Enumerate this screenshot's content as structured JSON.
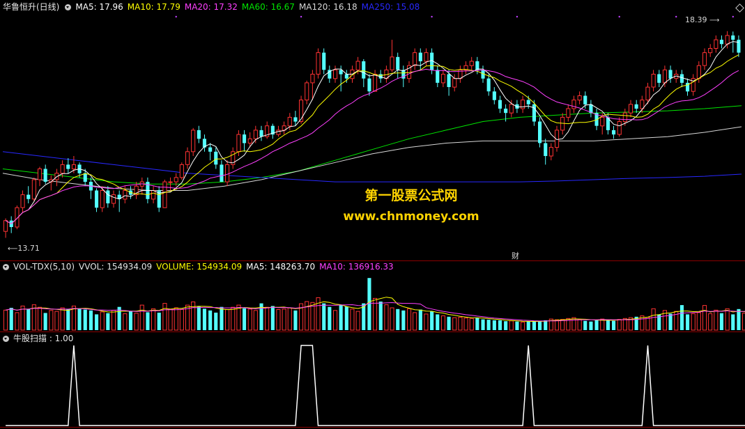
{
  "colors": {
    "up": "#ff3232",
    "down": "#54ffff",
    "ma5": "#ffffff",
    "ma10": "#ffff00",
    "ma20": "#ff40ff",
    "ma60": "#00e600",
    "ma120": "#d8d8d8",
    "ma250": "#2828ff",
    "bg": "#000000",
    "divider": "#8c0000",
    "vol_ma5": "#ffff00",
    "vol_ma10": "#ff40ff",
    "signal": "#ffffff",
    "watermark": "#ffd400",
    "marker_dot": "#c040ff"
  },
  "header": {
    "stock_name": "华鲁恒升(日线)",
    "ma_items": [
      {
        "label": "MA5: 17.96",
        "color": "#ffffff"
      },
      {
        "label": "MA10: 17.79",
        "color": "#ffff00"
      },
      {
        "label": "MA20: 17.32",
        "color": "#ff40ff"
      },
      {
        "label": "MA60: 16.67",
        "color": "#00e600"
      },
      {
        "label": "MA120: 16.18",
        "color": "#d8d8d8"
      },
      {
        "label": "MA250: 15.08",
        "color": "#2828ff"
      }
    ]
  },
  "volume_header": {
    "indicator": "VOL-TDX(5,10)",
    "items": [
      {
        "label": "VVOL: 154934.09",
        "color": "#e6e6e6"
      },
      {
        "label": "VOLUME: 154934.09",
        "color": "#ffff00"
      },
      {
        "label": "MA5: 148263.70",
        "color": "#ffffff"
      },
      {
        "label": "MA10: 136916.33",
        "color": "#ff40ff"
      }
    ]
  },
  "signal_header": {
    "label": "牛股扫描 : 1.00"
  },
  "watermark": {
    "line1": "第一股票公式网",
    "line2": "www.chnmoney.com"
  },
  "annotations": {
    "high_label": "18.39",
    "low_label": "13.71",
    "cai_marker": "财"
  },
  "chart_data": [
    {
      "type": "candlestick",
      "title": "华鲁恒升(日线)",
      "ylim": [
        13.3,
        18.8
      ],
      "candles": [
        [
          13.75,
          14.0,
          13.6,
          14.05
        ],
        [
          14.0,
          13.85,
          13.71,
          14.1
        ],
        [
          13.85,
          14.3,
          13.8,
          14.35
        ],
        [
          14.3,
          14.6,
          14.2,
          14.7
        ],
        [
          14.6,
          14.5,
          14.4,
          14.8
        ],
        [
          14.5,
          14.95,
          14.45,
          15.0
        ],
        [
          14.95,
          15.2,
          14.8,
          15.25
        ],
        [
          15.2,
          14.9,
          14.85,
          15.3
        ],
        [
          14.9,
          14.95,
          14.7,
          15.05
        ],
        [
          14.95,
          15.1,
          14.8,
          15.2
        ],
        [
          15.1,
          15.3,
          15.0,
          15.4
        ],
        [
          15.3,
          15.2,
          15.1,
          15.45
        ],
        [
          15.2,
          15.3,
          15.1,
          15.5
        ],
        [
          15.3,
          15.1,
          15.0,
          15.35
        ],
        [
          15.1,
          14.9,
          14.8,
          15.2
        ],
        [
          14.9,
          14.7,
          14.5,
          15.0
        ],
        [
          14.7,
          14.3,
          14.2,
          14.75
        ],
        [
          14.3,
          14.7,
          14.2,
          14.8
        ],
        [
          14.7,
          14.4,
          14.3,
          14.8
        ],
        [
          14.4,
          14.6,
          14.3,
          14.7
        ],
        [
          14.6,
          14.5,
          14.2,
          14.7
        ],
        [
          14.5,
          14.7,
          14.4,
          14.8
        ],
        [
          14.7,
          14.6,
          14.5,
          14.8
        ],
        [
          14.6,
          14.8,
          14.5,
          14.9
        ],
        [
          14.8,
          14.9,
          14.6,
          15.0
        ],
        [
          14.9,
          14.5,
          14.4,
          15.0
        ],
        [
          14.5,
          14.7,
          14.4,
          14.8
        ],
        [
          14.7,
          14.3,
          14.2,
          14.8
        ],
        [
          14.3,
          14.9,
          14.3,
          14.95
        ],
        [
          14.9,
          14.9,
          14.7,
          15.0
        ],
        [
          14.9,
          15.0,
          14.8,
          15.1
        ],
        [
          15.0,
          15.3,
          14.95,
          15.35
        ],
        [
          15.3,
          15.6,
          15.2,
          15.7
        ],
        [
          15.6,
          16.1,
          15.5,
          16.15
        ],
        [
          16.1,
          15.9,
          15.8,
          16.2
        ],
        [
          15.9,
          15.7,
          15.6,
          16.0
        ],
        [
          15.7,
          15.6,
          15.4,
          15.8
        ],
        [
          15.6,
          15.3,
          15.2,
          15.7
        ],
        [
          15.3,
          14.9,
          14.9,
          15.4
        ],
        [
          14.9,
          15.3,
          14.8,
          15.4
        ],
        [
          15.3,
          15.6,
          15.2,
          15.7
        ],
        [
          15.6,
          16.0,
          15.5,
          16.1
        ],
        [
          16.0,
          15.8,
          15.6,
          16.1
        ],
        [
          15.8,
          15.9,
          15.7,
          16.05
        ],
        [
          15.9,
          16.1,
          15.8,
          16.2
        ],
        [
          16.1,
          15.95,
          15.85,
          16.2
        ],
        [
          15.95,
          16.2,
          15.9,
          16.3
        ],
        [
          16.2,
          16.0,
          15.9,
          16.25
        ],
        [
          16.0,
          16.1,
          15.95,
          16.2
        ],
        [
          16.1,
          16.2,
          16.0,
          16.3
        ],
        [
          16.2,
          16.4,
          16.1,
          16.5
        ],
        [
          16.4,
          16.3,
          16.2,
          16.55
        ],
        [
          16.3,
          16.8,
          16.25,
          16.9
        ],
        [
          16.8,
          17.2,
          16.7,
          17.25
        ],
        [
          17.2,
          17.4,
          16.8,
          17.5
        ],
        [
          17.4,
          17.9,
          17.3,
          18.0
        ],
        [
          17.9,
          17.5,
          17.4,
          18.0
        ],
        [
          17.5,
          17.3,
          17.2,
          17.6
        ],
        [
          17.3,
          17.5,
          17.2,
          17.6
        ],
        [
          17.5,
          17.4,
          17.0,
          17.6
        ],
        [
          17.4,
          17.3,
          17.2,
          17.5
        ],
        [
          17.3,
          17.5,
          17.2,
          17.6
        ],
        [
          17.5,
          17.7,
          17.4,
          17.8
        ],
        [
          17.7,
          17.3,
          17.1,
          17.75
        ],
        [
          17.3,
          17.0,
          16.9,
          17.4
        ],
        [
          17.0,
          17.4,
          17.0,
          17.5
        ],
        [
          17.4,
          17.3,
          17.2,
          17.5
        ],
        [
          17.3,
          17.5,
          17.2,
          17.6
        ],
        [
          17.5,
          17.8,
          17.45,
          18.2
        ],
        [
          17.8,
          17.5,
          17.3,
          17.9
        ],
        [
          17.5,
          17.3,
          17.1,
          17.6
        ],
        [
          17.3,
          17.6,
          17.2,
          17.7
        ],
        [
          17.6,
          17.9,
          17.5,
          18.0
        ],
        [
          17.9,
          17.7,
          17.5,
          18.0
        ],
        [
          17.7,
          17.9,
          17.6,
          18.0
        ],
        [
          17.9,
          17.5,
          17.4,
          18.0
        ],
        [
          17.5,
          17.2,
          17.1,
          17.6
        ],
        [
          17.2,
          17.4,
          17.1,
          17.5
        ],
        [
          17.4,
          17.1,
          16.9,
          17.5
        ],
        [
          17.1,
          17.3,
          17.0,
          17.4
        ],
        [
          17.3,
          17.5,
          17.2,
          17.6
        ],
        [
          17.5,
          17.6,
          17.4,
          17.7
        ],
        [
          17.6,
          17.7,
          17.5,
          17.8
        ],
        [
          17.7,
          17.5,
          17.4,
          17.8
        ],
        [
          17.5,
          17.3,
          17.2,
          17.6
        ],
        [
          17.3,
          17.0,
          16.9,
          17.4
        ],
        [
          17.0,
          16.8,
          16.7,
          17.1
        ],
        [
          16.8,
          16.6,
          16.5,
          16.9
        ],
        [
          16.6,
          16.5,
          16.3,
          16.7
        ],
        [
          16.5,
          16.7,
          16.4,
          16.8
        ],
        [
          16.7,
          16.6,
          16.5,
          16.8
        ],
        [
          16.6,
          16.8,
          16.5,
          16.9
        ],
        [
          16.8,
          16.7,
          16.6,
          16.9
        ],
        [
          16.7,
          16.3,
          16.2,
          16.8
        ],
        [
          16.3,
          15.8,
          15.7,
          16.4
        ],
        [
          15.8,
          15.5,
          15.3,
          15.9
        ],
        [
          15.5,
          15.7,
          15.4,
          15.8
        ],
        [
          15.7,
          16.1,
          15.6,
          16.2
        ],
        [
          16.1,
          16.4,
          16.0,
          16.5
        ],
        [
          16.4,
          16.6,
          16.3,
          16.7
        ],
        [
          16.6,
          16.8,
          16.5,
          16.9
        ],
        [
          16.8,
          16.9,
          16.7,
          17.0
        ],
        [
          16.9,
          16.7,
          16.6,
          17.0
        ],
        [
          16.7,
          16.5,
          16.4,
          16.8
        ],
        [
          16.5,
          16.2,
          16.1,
          16.6
        ],
        [
          16.2,
          16.4,
          16.0,
          16.5
        ],
        [
          16.4,
          16.1,
          16.0,
          16.5
        ],
        [
          16.1,
          16.0,
          15.9,
          16.2
        ],
        [
          16.0,
          16.3,
          15.95,
          16.4
        ],
        [
          16.3,
          16.5,
          16.2,
          16.6
        ],
        [
          16.5,
          16.7,
          16.4,
          16.8
        ],
        [
          16.7,
          16.6,
          16.5,
          16.8
        ],
        [
          16.6,
          16.8,
          16.5,
          16.9
        ],
        [
          16.8,
          17.1,
          16.7,
          17.2
        ],
        [
          17.1,
          17.4,
          17.0,
          17.5
        ],
        [
          17.4,
          17.2,
          17.1,
          17.5
        ],
        [
          17.2,
          17.5,
          17.1,
          17.6
        ],
        [
          17.5,
          17.3,
          17.2,
          17.6
        ],
        [
          17.3,
          17.4,
          17.2,
          17.5
        ],
        [
          17.4,
          17.2,
          17.1,
          17.5
        ],
        [
          17.2,
          17.0,
          16.9,
          17.3
        ],
        [
          17.0,
          17.3,
          16.9,
          17.4
        ],
        [
          17.3,
          17.6,
          17.2,
          17.7
        ],
        [
          17.6,
          17.9,
          17.5,
          18.0
        ],
        [
          17.9,
          18.0,
          17.8,
          18.1
        ],
        [
          18.0,
          18.2,
          17.9,
          18.3
        ],
        [
          18.2,
          18.1,
          18.0,
          18.3
        ],
        [
          18.1,
          18.3,
          18.0,
          18.4
        ],
        [
          18.3,
          18.2,
          17.9,
          18.39
        ],
        [
          18.2,
          17.9,
          17.8,
          18.3
        ]
      ],
      "ma": [
        {
          "name": "MA5",
          "color": "#ffffff",
          "window": 5
        },
        {
          "name": "MA10",
          "color": "#ffff00",
          "window": 10
        },
        {
          "name": "MA20",
          "color": "#ff40ff",
          "window": 20
        }
      ],
      "long_ma": [
        {
          "name": "MA60",
          "color": "#00e600",
          "values": [
            15.2,
            15.1,
            15.0,
            14.9,
            14.85,
            14.85,
            14.9,
            15.0,
            15.15,
            15.4,
            15.65,
            15.9,
            16.1,
            16.3,
            16.4,
            16.45,
            16.5,
            16.52,
            16.55,
            16.6,
            16.67
          ]
        },
        {
          "name": "MA120",
          "color": "#d8d8d8",
          "values": [
            15.1,
            14.95,
            14.85,
            14.75,
            14.7,
            14.7,
            14.8,
            14.95,
            15.15,
            15.35,
            15.55,
            15.7,
            15.8,
            15.85,
            15.85,
            15.85,
            15.85,
            15.9,
            15.95,
            16.05,
            16.18
          ]
        },
        {
          "name": "MA250",
          "color": "#2828ff",
          "values": [
            15.6,
            15.5,
            15.4,
            15.3,
            15.2,
            15.1,
            15.05,
            15.0,
            14.95,
            14.9,
            14.9,
            14.9,
            14.9,
            14.9,
            14.9,
            14.92,
            14.95,
            14.98,
            15.0,
            15.03,
            15.08
          ]
        }
      ]
    },
    {
      "type": "bar",
      "title": "VOL-TDX(5,10)",
      "ylim": [
        0,
        320000
      ],
      "values": [
        112000,
        125000,
        98000,
        135000,
        118000,
        142000,
        128000,
        96000,
        110000,
        105000,
        125000,
        118000,
        135000,
        120000,
        115000,
        110000,
        88000,
        102000,
        95000,
        110000,
        130000,
        92000,
        105000,
        95000,
        140000,
        100000,
        120000,
        98000,
        150000,
        118000,
        125000,
        115000,
        140000,
        158000,
        132000,
        120000,
        110000,
        98000,
        130000,
        115000,
        128000,
        140000,
        122000,
        118000,
        110000,
        150000,
        128000,
        135000,
        115000,
        118000,
        125000,
        110000,
        148000,
        160000,
        155000,
        182000,
        150000,
        130000,
        110000,
        140000,
        132000,
        118000,
        105000,
        150000,
        292000,
        178000,
        160000,
        142000,
        125000,
        118000,
        110000,
        120000,
        98000,
        115000,
        90000,
        105000,
        88000,
        80000,
        75000,
        70000,
        72000,
        68000,
        65000,
        70000,
        60000,
        58000,
        55000,
        55000,
        50000,
        52000,
        48000,
        45000,
        50000,
        48000,
        52000,
        55000,
        62000,
        58000,
        60000,
        65000,
        70000,
        58000,
        52000,
        48000,
        55000,
        62000,
        58000,
        52000,
        60000,
        65000,
        70000,
        75000,
        80000,
        72000,
        120000,
        88000,
        110000,
        92000,
        105000,
        140000,
        88000,
        92000,
        98000,
        138000,
        92000,
        112000,
        95000,
        120000,
        88000,
        118000,
        95000,
        130000,
        154934
      ]
    },
    {
      "type": "line",
      "title": "牛股扫描",
      "ylim": [
        0,
        1
      ],
      "values": [
        0,
        0,
        0,
        0,
        0,
        0,
        0,
        0,
        0,
        0,
        0,
        0,
        1,
        0,
        0,
        0,
        0,
        0,
        0,
        0,
        0,
        0,
        0,
        0,
        0,
        0,
        0,
        0,
        0,
        0,
        0,
        0,
        0,
        0,
        0,
        0,
        0,
        0,
        0,
        0,
        0,
        0,
        0,
        0,
        0,
        0,
        0,
        0,
        0,
        0,
        0,
        0,
        1,
        1,
        1,
        0,
        0,
        0,
        0,
        0,
        0,
        0,
        0,
        0,
        0,
        0,
        0,
        0,
        0,
        0,
        0,
        0,
        0,
        0,
        0,
        0,
        0,
        0,
        0,
        0,
        0,
        0,
        0,
        0,
        0,
        0,
        0,
        0,
        0,
        0,
        0,
        0,
        1,
        0,
        0,
        0,
        0,
        0,
        0,
        0,
        0,
        0,
        0,
        0,
        0,
        0,
        0,
        0,
        0,
        0,
        0,
        0,
        0,
        1,
        0,
        0,
        0,
        0,
        0,
        0,
        0,
        0,
        0,
        0,
        0,
        0,
        0,
        0,
        0,
        0,
        0,
        0,
        0,
        0,
        0,
        0,
        0,
        0,
        0
      ]
    }
  ]
}
